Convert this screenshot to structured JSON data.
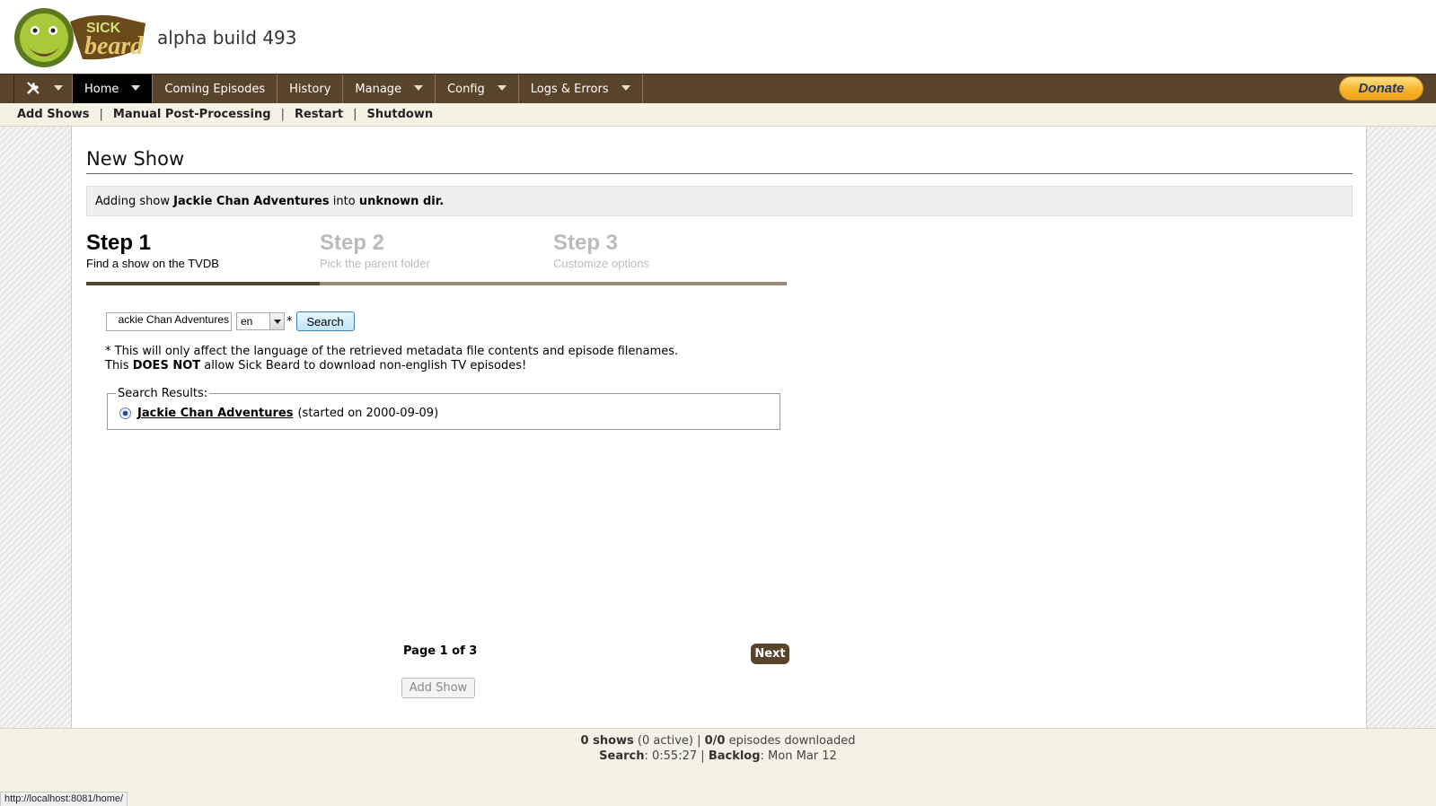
{
  "header": {
    "build": "alpha build 493",
    "logo_text_top": "SICK",
    "logo_text_bottom": "beard"
  },
  "nav": {
    "items": [
      {
        "label": "Home",
        "dropdown": true
      },
      {
        "label": "Coming Episodes",
        "dropdown": false
      },
      {
        "label": "History",
        "dropdown": false
      },
      {
        "label": "Manage",
        "dropdown": true
      },
      {
        "label": "Config",
        "dropdown": true
      },
      {
        "label": "Logs & Errors",
        "dropdown": true
      }
    ],
    "donate_label": "Donate"
  },
  "subnav": {
    "items": [
      "Add Shows",
      "Manual Post-Processing",
      "Restart",
      "Shutdown"
    ],
    "separator": "|"
  },
  "main": {
    "title": "New Show",
    "info": {
      "prefix": "Adding show",
      "show": "Jackie Chan Adventures",
      "middle": "into",
      "dir": "unknown dir."
    },
    "steps": [
      {
        "title": "Step 1",
        "desc": "Find a show on the TVDB"
      },
      {
        "title": "Step 2",
        "desc": "Pick the parent folder"
      },
      {
        "title": "Step 3",
        "desc": "Customize options"
      }
    ],
    "search": {
      "value": "ackie Chan Adventures",
      "language": "en",
      "asterisk": "*",
      "button": "Search"
    },
    "note": {
      "line1": "* This will only affect the language of the retrieved metadata file contents and episode filenames.",
      "line2_prefix": "This",
      "line2_bold": "DOES NOT",
      "line2_suffix": "allow Sick Beard to download non-english TV episodes!"
    },
    "results": {
      "legend": "Search Results:",
      "items": [
        {
          "name": "Jackie Chan Adventures",
          "detail": "(started on 2000-09-09)"
        }
      ]
    },
    "pager": "Page 1 of 3",
    "next_label": "Next",
    "add_show_label": "Add Show"
  },
  "footer": {
    "shows_count": "0 shows",
    "active": "(0 active)",
    "sep": "|",
    "episodes": "0/0",
    "episodes_label": "episodes downloaded",
    "search_label": "Search",
    "search_value": ": 0:55:27",
    "backlog_label": "Backlog",
    "backlog_value": ": Mon Mar 12"
  },
  "statusbar": {
    "url": "http://localhost:8081/home/"
  },
  "colors": {
    "nav_bg": "#57442b",
    "subnav_bg": "#f5f1e4",
    "accent": "#57442b",
    "donate": "#f7b42b"
  }
}
